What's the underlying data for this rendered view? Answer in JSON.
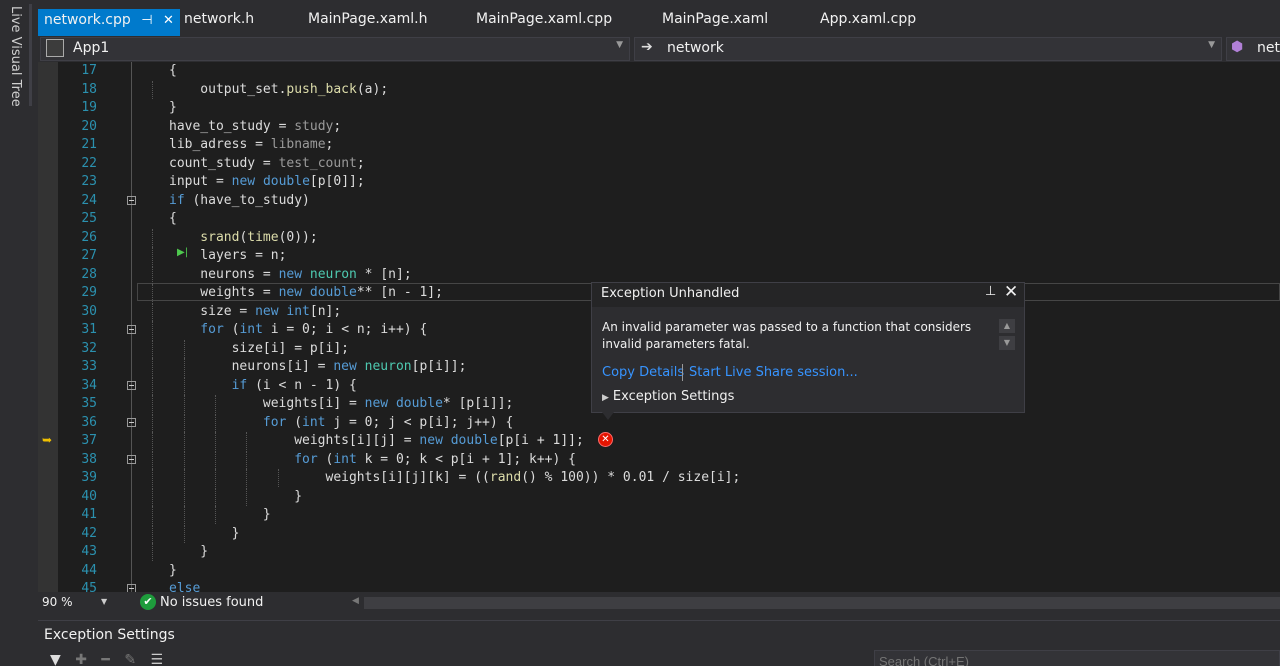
{
  "side_tab": {
    "label": "Live Visual Tree"
  },
  "tabs": [
    {
      "label": "network.cpp",
      "active": true
    },
    {
      "label": "network.h"
    },
    {
      "label": "MainPage.xaml.h"
    },
    {
      "label": "MainPage.xaml.cpp"
    },
    {
      "label": "MainPage.xaml"
    },
    {
      "label": "App.xaml.cpp"
    }
  ],
  "navbar": {
    "project": "App1",
    "scope": "network",
    "member": "netwo"
  },
  "code": {
    "current_line": 29,
    "exec_line": 37,
    "lines": [
      {
        "n": "17",
        "indent": 1,
        "text": "{"
      },
      {
        "n": "18",
        "indent": 2,
        "text": "output_set.push_back(a);"
      },
      {
        "n": "19",
        "indent": 1,
        "text": "}"
      },
      {
        "n": "20",
        "indent": 1,
        "text": "have_to_study = study;"
      },
      {
        "n": "21",
        "indent": 1,
        "text": "lib_adress = libname;"
      },
      {
        "n": "22",
        "indent": 1,
        "text": "count_study = test_count;"
      },
      {
        "n": "23",
        "indent": 1,
        "text": "input = new double[p[0]];"
      },
      {
        "n": "24",
        "indent": 1,
        "text": "if (have_to_study)",
        "fold": true
      },
      {
        "n": "25",
        "indent": 1,
        "text": "{"
      },
      {
        "n": "26",
        "indent": 2,
        "text": "srand(time(0));"
      },
      {
        "n": "27",
        "indent": 2,
        "text": "layers = n;"
      },
      {
        "n": "28",
        "indent": 2,
        "text": "neurons = new neuron * [n];"
      },
      {
        "n": "29",
        "indent": 2,
        "text": "weights = new double** [n - 1];"
      },
      {
        "n": "30",
        "indent": 2,
        "text": "size = new int[n];"
      },
      {
        "n": "31",
        "indent": 2,
        "text": "for (int i = 0; i < n; i++) {",
        "fold": true
      },
      {
        "n": "32",
        "indent": 3,
        "text": "size[i] = p[i];"
      },
      {
        "n": "33",
        "indent": 3,
        "text": "neurons[i] = new neuron[p[i]];"
      },
      {
        "n": "34",
        "indent": 3,
        "text": "if (i < n - 1) {",
        "fold": true
      },
      {
        "n": "35",
        "indent": 4,
        "text": "weights[i] = new double* [p[i]];"
      },
      {
        "n": "36",
        "indent": 4,
        "text": "for (int j = 0; j < p[i]; j++) {",
        "fold": true
      },
      {
        "n": "37",
        "indent": 5,
        "text": "weights[i][j] = new double[p[i + 1]];"
      },
      {
        "n": "38",
        "indent": 5,
        "text": "for (int k = 0; k < p[i + 1]; k++) {",
        "fold": true
      },
      {
        "n": "39",
        "indent": 6,
        "text": "weights[i][j][k] = ((rand() % 100)) * 0.01 / size[i];"
      },
      {
        "n": "40",
        "indent": 5,
        "text": "}"
      },
      {
        "n": "41",
        "indent": 4,
        "text": "}"
      },
      {
        "n": "42",
        "indent": 3,
        "text": "}"
      },
      {
        "n": "43",
        "indent": 2,
        "text": "}"
      },
      {
        "n": "44",
        "indent": 1,
        "text": "}"
      },
      {
        "n": "45",
        "indent": 1,
        "text": "else",
        "fold": true
      }
    ]
  },
  "popup": {
    "title": "Exception Unhandled",
    "message": "An invalid parameter was passed to a function that considers invalid parameters fatal.",
    "copy_details": "Copy Details",
    "live_share": "Start Live Share session...",
    "settings": "Exception Settings"
  },
  "status": {
    "zoom": "90 %",
    "issues": "No issues found"
  },
  "bottom_panel": {
    "title": "Exception Settings",
    "search_placeholder": "Search (Ctrl+E)"
  }
}
